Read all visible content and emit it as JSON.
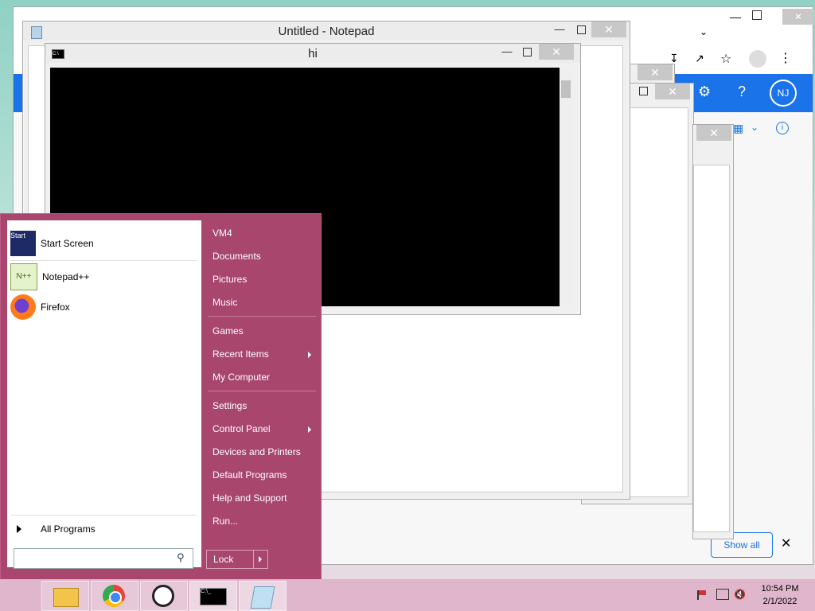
{
  "notepad": {
    "title": "Untitled - Notepad"
  },
  "cmd": {
    "title": "hi",
    "icon": "cmd-icon"
  },
  "chrome": {
    "avatar": "NJ",
    "show_all": "Show all"
  },
  "start_menu": {
    "programs": [
      {
        "label": "Start Screen",
        "icon": "start-screen-icon"
      },
      {
        "label": "Notepad++",
        "icon": "notepadpp-icon"
      },
      {
        "label": "Firefox",
        "icon": "firefox-icon"
      }
    ],
    "all_programs": "All Programs",
    "search_placeholder": "",
    "right_links": [
      {
        "label": "VM4"
      },
      {
        "label": "Documents"
      },
      {
        "label": "Pictures"
      },
      {
        "label": "Music"
      },
      {
        "label": "Games"
      },
      {
        "label": "Recent Items",
        "submenu": true
      },
      {
        "label": "My Computer"
      },
      {
        "label": "Settings"
      },
      {
        "label": "Control Panel",
        "submenu": true
      },
      {
        "label": "Devices and Printers"
      },
      {
        "label": "Default Programs"
      },
      {
        "label": "Help and Support"
      },
      {
        "label": "Run..."
      }
    ],
    "lock": "Lock"
  },
  "taskbar": {
    "apps": [
      "file-explorer-icon",
      "chrome-icon",
      "app-icon",
      "cmd-icon",
      "notepad-icon"
    ],
    "time": "10:54 PM",
    "date": "2/1/2022"
  },
  "colors": {
    "start_bg": "#a8466e",
    "accent_blue": "#1a73e8"
  }
}
